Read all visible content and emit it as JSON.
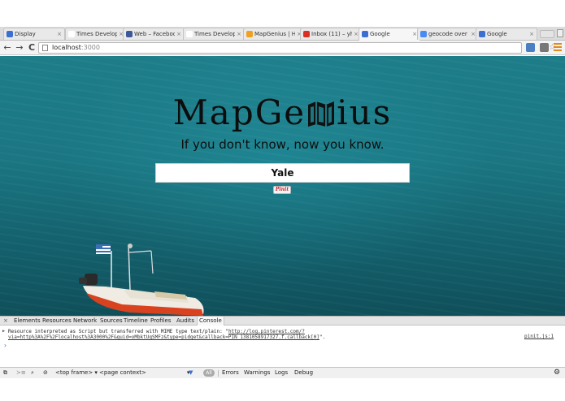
{
  "browser": {
    "tabs": [
      {
        "label": "Display",
        "favicon_color": "#3b6fd1"
      },
      {
        "label": "Times Develop",
        "favicon_color": "#ffffff"
      },
      {
        "label": "Web – Faceboo",
        "favicon_color": "#3b5998"
      },
      {
        "label": "Times Develop",
        "favicon_color": "#ffffff"
      },
      {
        "label": "MapGenius | H",
        "favicon_color": "#f0a020"
      },
      {
        "label": "Inbox (11) – yh",
        "favicon_color": "#d93025"
      },
      {
        "label": "Google",
        "favicon_color": "#3b6fd1"
      },
      {
        "label": "geocode over a",
        "favicon_color": "#4a8af4"
      },
      {
        "label": "Google",
        "favicon_color": "#3b6fd1"
      }
    ],
    "active_tab_index": 6,
    "close_glyph": "×",
    "nav": {
      "back": "←",
      "forward": "→",
      "reload": "C"
    },
    "address": {
      "host": "localhost",
      "port": ":3000"
    },
    "star": "☆",
    "extensions": [
      {
        "name": "ext-blue",
        "color": "#4a7fc1"
      },
      {
        "name": "ext-camera",
        "color": "#777777"
      }
    ],
    "menu_accent": "#e08a1e"
  },
  "page": {
    "logo_pre": "MapGe",
    "logo_post": "ius",
    "tagline": "If you don't know, now you know.",
    "search_value": "Yale",
    "pinit_label": "Pinit"
  },
  "devtools": {
    "close_glyph": "×",
    "tabs": [
      "Elements",
      "Resources",
      "Network",
      "Sources",
      "Timeline",
      "Profiles",
      "Audits",
      "Console"
    ],
    "active_tab": "Console",
    "console": {
      "message_pre": "Resource interpreted as Script but transferred with MIME type text/plain: \"",
      "message_url": "http://log.pinterest.com/?via=http%3A%2F%2Flocalhost%3A3000%2F&guid=oMbktUqSMFz&type=pidget&callback=PIN_1381058917327.f.callback[0]",
      "message_post": "\".",
      "source": "pinit.js:1",
      "prompt": "›"
    },
    "bottom": {
      "frame": "<top frame>",
      "context": "<page context>",
      "all": "All",
      "filters": [
        "Errors",
        "Warnings",
        "Logs",
        "Debug"
      ]
    }
  }
}
